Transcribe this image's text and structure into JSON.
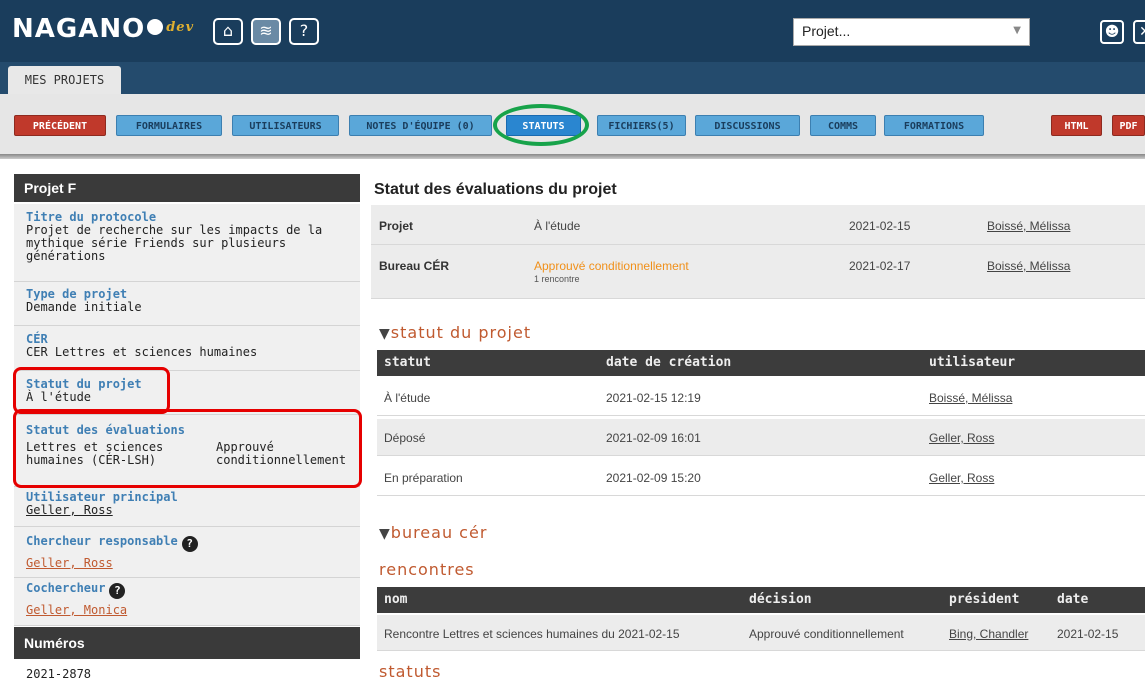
{
  "header": {
    "logo": "NAGANO",
    "logo_suffix": "dev",
    "project_select": "Projet...",
    "icons": [
      "home-icon",
      "layers-icon",
      "help-icon",
      "user-icon",
      "close-icon"
    ]
  },
  "tabs": [
    {
      "label": "MES PROJETS"
    }
  ],
  "toolbar": {
    "buttons": [
      {
        "label": "PRÉCÉDENT"
      },
      {
        "label": "FORMULAIRES"
      },
      {
        "label": "UTILISATEURS"
      },
      {
        "label": "NOTES D'ÉQUIPE (0)"
      },
      {
        "label": "STATUTS"
      },
      {
        "label": "FICHIERS(5)"
      },
      {
        "label": "DISCUSSIONS"
      },
      {
        "label": "COMMS"
      },
      {
        "label": "FORMATIONS"
      },
      {
        "label": "HTML"
      },
      {
        "label": "PDF"
      }
    ]
  },
  "sidebar": {
    "title": "Projet F",
    "titre_label": "Titre du protocole",
    "titre_lines": [
      "Projet de recherche sur les impacts de la",
      "mythique série Friends sur plusieurs",
      "générations"
    ],
    "type_label": "Type de projet",
    "type_value": "Demande initiale",
    "cer_label": "CÉR",
    "cer_value": "CER Lettres et sciences humaines",
    "statut_label": "Statut du projet",
    "statut_value": "À l'étude",
    "evals_label": "Statut des évaluations",
    "evals_col1": [
      "Lettres et sciences",
      "humaines (CÉR-LSH)"
    ],
    "evals_col2": [
      "Approuvé",
      "conditionnellement"
    ],
    "user_label": "Utilisateur principal",
    "user_value": "Geller, Ross",
    "chercheur_label": "Chercheur responsable",
    "chercheur_value": "Geller, Ross",
    "cochercheur_label": "Cochercheur",
    "cochercheur_value": "Geller, Monica",
    "numeros_title": "Numéros",
    "numero": "2021-2878"
  },
  "main": {
    "title": "Statut des évaluations du projet",
    "eval_rows": [
      {
        "name": "Projet",
        "status": "À l'étude",
        "sub": "",
        "date": "2021-02-15",
        "user": "Boissé, Mélissa"
      },
      {
        "name": "Bureau CÉR",
        "status": "Approuvé conditionnellement",
        "sub": "1 rencontre",
        "date": "2021-02-17",
        "user": "Boissé, Mélissa"
      }
    ],
    "statut_section": "statut du projet",
    "statut_headers": [
      "statut",
      "date de création",
      "utilisateur"
    ],
    "statut_rows": [
      {
        "statut": "À l'étude",
        "date": "2021-02-15 12:19",
        "user": "Boissé, Mélissa"
      },
      {
        "statut": "Déposé",
        "date": "2021-02-09 16:01",
        "user": "Geller, Ross"
      },
      {
        "statut": "En préparation",
        "date": "2021-02-09 15:20",
        "user": "Geller, Ross"
      }
    ],
    "bureau_section": "bureau cér",
    "rencontres_section": "rencontres",
    "rencontres_headers": [
      "nom",
      "décision",
      "président",
      "date"
    ],
    "rencontres_rows": [
      {
        "nom": "Rencontre Lettres et sciences humaines du 2021-02-15",
        "decision": "Approuvé conditionnellement",
        "president": "Bing, Chandler",
        "date": "2021-02-15"
      }
    ],
    "statuts_section": "statuts"
  },
  "colors": {
    "header": "#1a3d5c",
    "button": "#5aa7d9",
    "button_red": "#c0392b",
    "highlight_red": "#e60000",
    "highlight_green": "#17a34a",
    "accent_orange": "#c05a30"
  }
}
